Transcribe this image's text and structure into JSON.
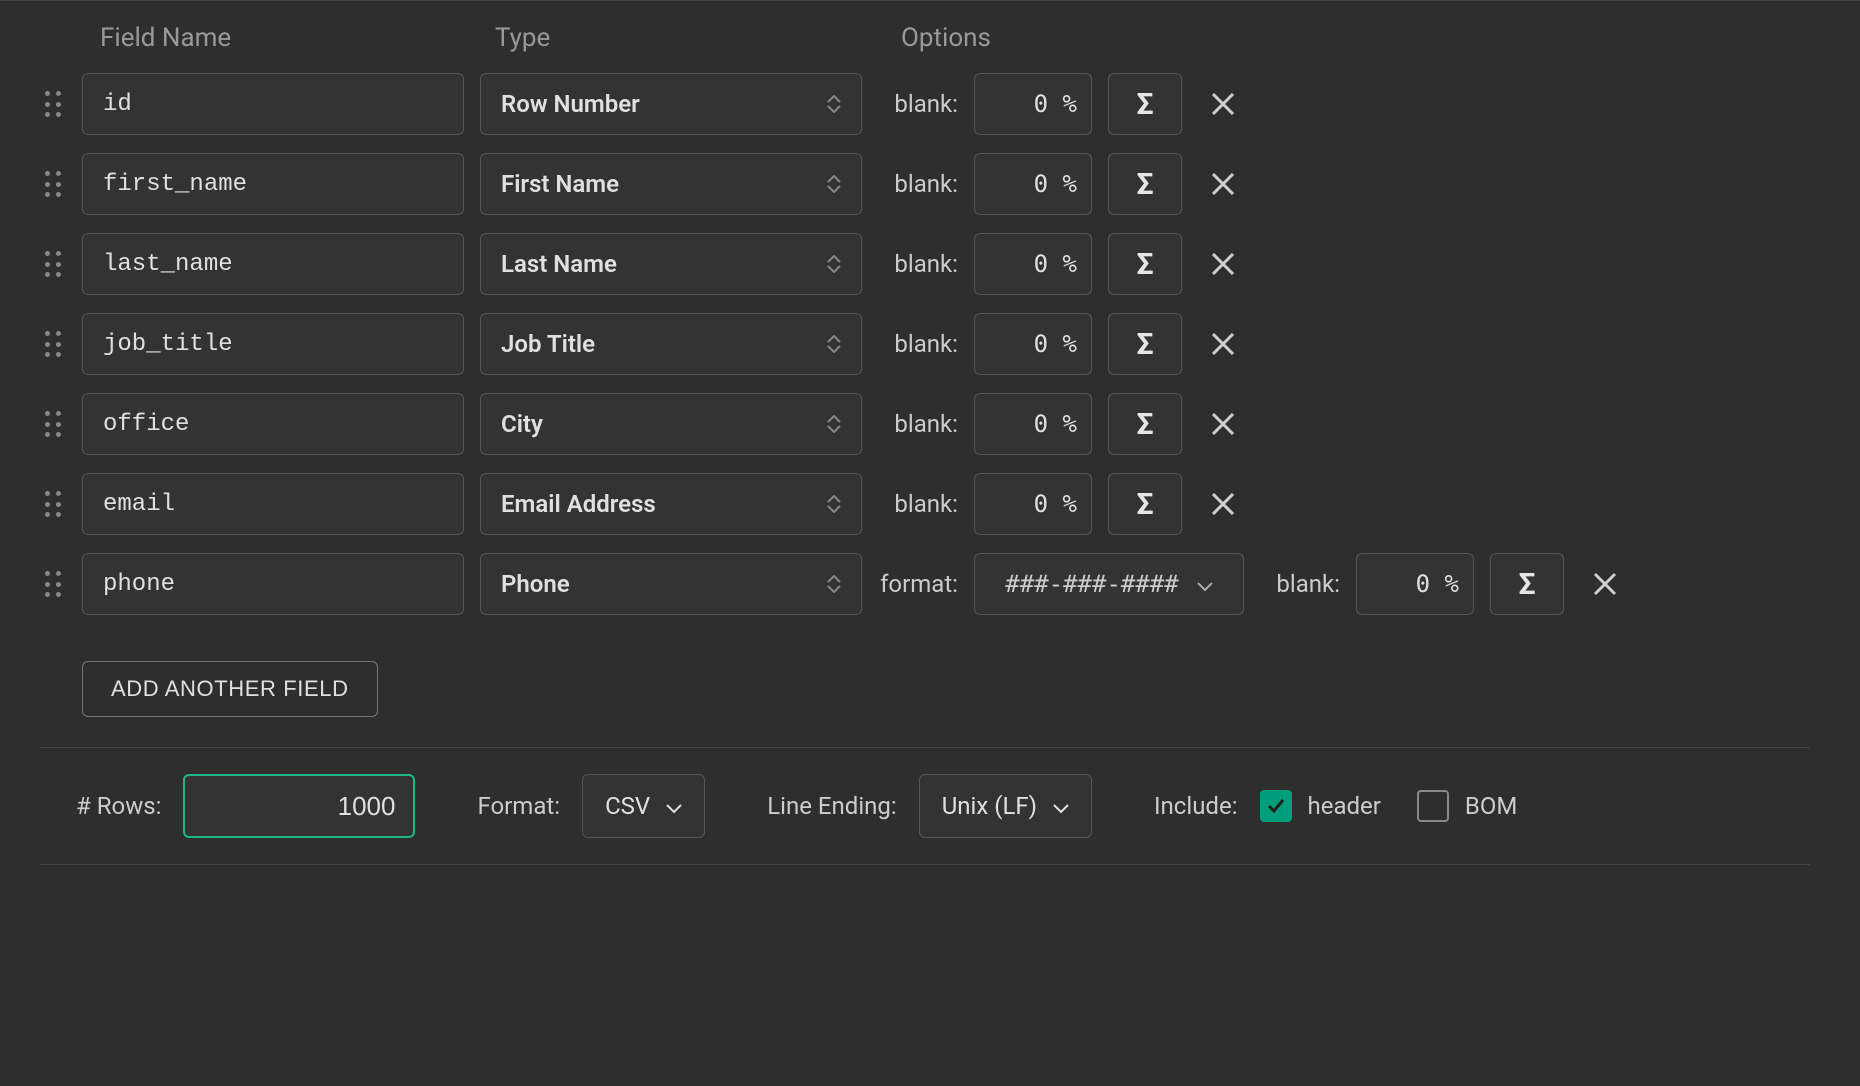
{
  "headers": {
    "field_name": "Field Name",
    "type": "Type",
    "options": "Options"
  },
  "labels": {
    "blank": "blank:",
    "format": "format:",
    "add_field": "ADD ANOTHER FIELD",
    "rows": "# Rows:",
    "format_footer": "Format:",
    "line_ending": "Line Ending:",
    "include": "Include:",
    "header": "header",
    "bom": "BOM"
  },
  "fields": [
    {
      "name": "id",
      "type": "Row Number",
      "blank": "0 %",
      "format": null
    },
    {
      "name": "first_name",
      "type": "First Name",
      "blank": "0 %",
      "format": null
    },
    {
      "name": "last_name",
      "type": "Last Name",
      "blank": "0 %",
      "format": null
    },
    {
      "name": "job_title",
      "type": "Job Title",
      "blank": "0 %",
      "format": null
    },
    {
      "name": "office",
      "type": "City",
      "blank": "0 %",
      "format": null
    },
    {
      "name": "email",
      "type": "Email Address",
      "blank": "0 %",
      "format": null
    },
    {
      "name": "phone",
      "type": "Phone",
      "blank": "0 %",
      "format": "###-###-####"
    }
  ],
  "footer": {
    "rows": "1000",
    "format": "CSV",
    "line_ending": "Unix (LF)",
    "include_header": true,
    "include_bom": false
  }
}
